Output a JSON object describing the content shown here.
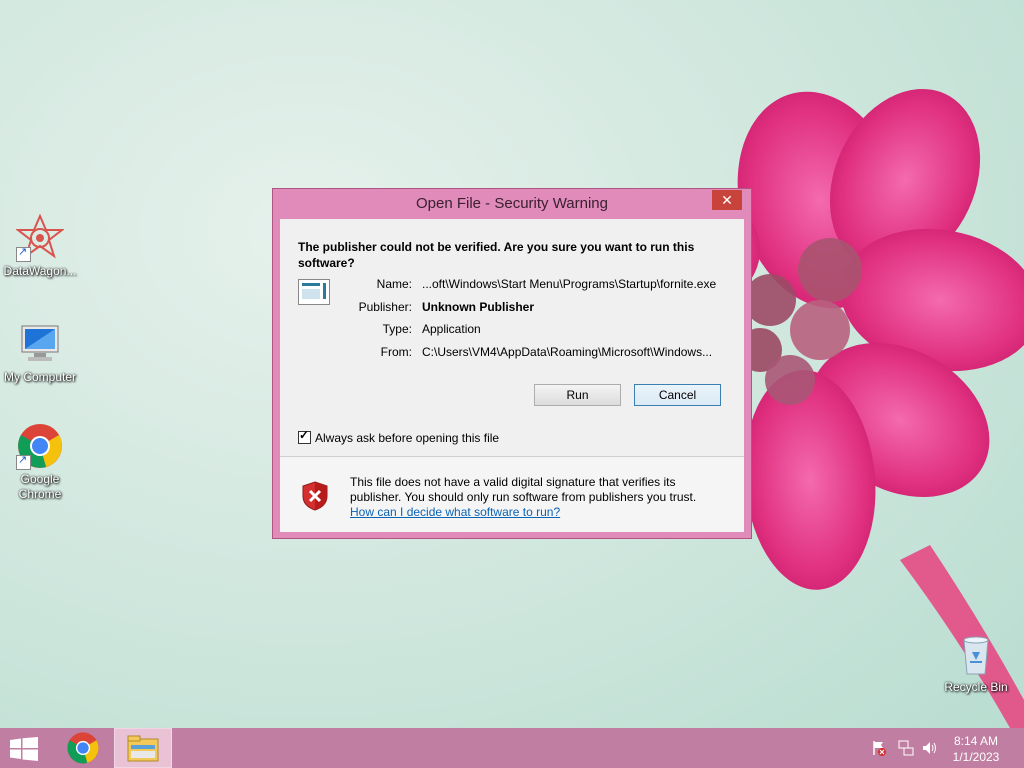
{
  "desktop": {
    "icons": [
      {
        "label": "DataWagon..."
      },
      {
        "label": "My Computer"
      },
      {
        "label": "Google Chrome"
      },
      {
        "label": "Recycle Bin"
      }
    ]
  },
  "dialog": {
    "title": "Open File - Security Warning",
    "close_label": "✕",
    "headline": "The publisher could not be verified.  Are you sure you want to run this software?",
    "fields": [
      {
        "key": "Name:",
        "value": "...oft\\Windows\\Start Menu\\Programs\\Startup\\fornite.exe"
      },
      {
        "key": "Publisher:",
        "value": "Unknown Publisher"
      },
      {
        "key": "Type:",
        "value": "Application"
      },
      {
        "key": "From:",
        "value": "C:\\Users\\VM4\\AppData\\Roaming\\Microsoft\\Windows..."
      }
    ],
    "run_label": "Run",
    "cancel_label": "Cancel",
    "checkbox_label": "Always ask before opening this file",
    "checkbox_checked": true,
    "warning_text": "This file does not have a valid digital signature that verifies its publisher.  You should only run software from publishers you trust.",
    "help_link": "How can I decide what software to run?"
  },
  "taskbar": {
    "icons": [
      "windows-start-icon",
      "chrome-icon",
      "file-explorer-icon"
    ],
    "tray_icons": [
      "action-center-flag-icon",
      "network-icon",
      "volume-icon"
    ],
    "time": "8:14 AM",
    "date": "1/1/2023"
  },
  "colors": {
    "dialog_frame": "#e08bba",
    "close_button": "#c7433c",
    "taskbar": "#c07ea2",
    "link": "#0b63b6"
  }
}
